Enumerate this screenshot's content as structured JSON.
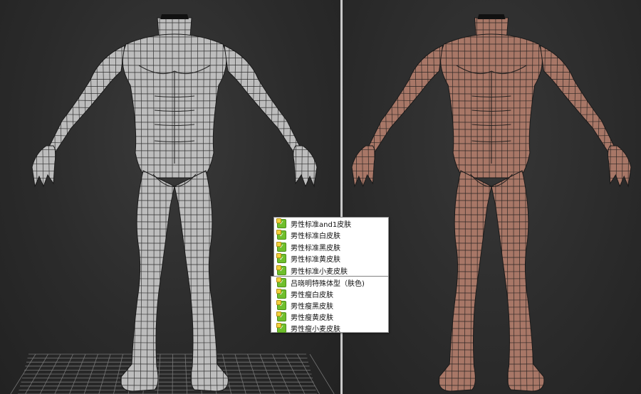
{
  "viewports": {
    "left": {
      "label": "wireframe-shaded",
      "mesh_color": "#bdbdbd"
    },
    "right": {
      "label": "skin-shaded",
      "mesh_color": "#a87767"
    }
  },
  "colors": {
    "background": "#2b2b2b",
    "divider": "#c9c9c9",
    "wire": "#1a1a1a",
    "grid": "#8a8a8a",
    "popup_bg": "#ffffff",
    "check": "#6fbf2c"
  },
  "icons": {
    "list_item": "green-check-icon"
  },
  "list_a": {
    "items": [
      "男性标准and1皮肤",
      "男性标准白皮肤",
      "男性标准黑皮肤",
      "男性标准黄皮肤",
      "男性标准小麦皮肤"
    ]
  },
  "list_b": {
    "items": [
      "吕晓明特殊体型（肤色)",
      "男性瘦白皮肤",
      "男性瘦黑皮肤",
      "男性瘦黄皮肤",
      "男性瘦小麦皮肤"
    ]
  }
}
